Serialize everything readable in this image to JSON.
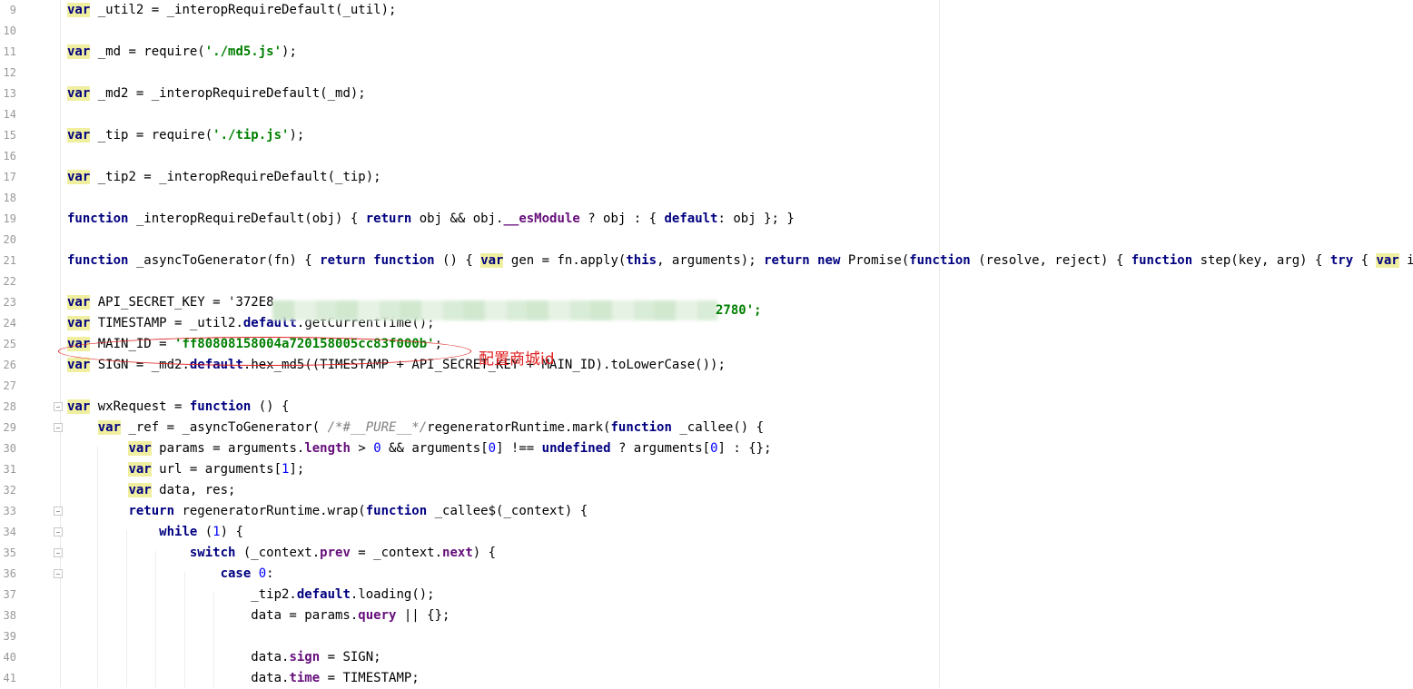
{
  "editor": {
    "lines": [
      {
        "num": "9",
        "text": "var _util2 = _interopRequireDefault(_util);"
      },
      {
        "num": "10",
        "text": ""
      },
      {
        "num": "11",
        "text": "var _md = require('./md5.js');"
      },
      {
        "num": "12",
        "text": ""
      },
      {
        "num": "13",
        "text": "var _md2 = _interopRequireDefault(_md);"
      },
      {
        "num": "14",
        "text": ""
      },
      {
        "num": "15",
        "text": "var _tip = require('./tip.js');"
      },
      {
        "num": "16",
        "text": ""
      },
      {
        "num": "17",
        "text": "var _tip2 = _interopRequireDefault(_tip);"
      },
      {
        "num": "18",
        "text": ""
      },
      {
        "num": "19",
        "text": "function _interopRequireDefault(obj) { return obj && obj.__esModule ? obj : { default: obj }; }"
      },
      {
        "num": "20",
        "text": ""
      },
      {
        "num": "21",
        "text": "function _asyncToGenerator(fn) { return function () { var gen = fn.apply(this, arguments); return new Promise(function (resolve, reject) { function step(key, arg) { try { var inf"
      },
      {
        "num": "22",
        "text": ""
      },
      {
        "num": "23",
        "text": "var API_SECRET_KEY = '372E8"
      },
      {
        "num": "24",
        "text": "var TIMESTAMP = _util2.default.getCurrentTime();"
      },
      {
        "num": "25",
        "text": "var MAIN_ID = 'ff80808158004a720158005cc83f000b';"
      },
      {
        "num": "26",
        "text": "var SIGN = _md2.default.hex_md5((TIMESTAMP + API_SECRET_KEY + MAIN_ID).toLowerCase());"
      },
      {
        "num": "27",
        "text": ""
      },
      {
        "num": "28",
        "text": "var wxRequest = function () {"
      },
      {
        "num": "29",
        "text": "    var _ref = _asyncToGenerator( /*#__PURE__*/regeneratorRuntime.mark(function _callee() {"
      },
      {
        "num": "30",
        "text": "        var params = arguments.length > 0 && arguments[0] !== undefined ? arguments[0] : {};"
      },
      {
        "num": "31",
        "text": "        var url = arguments[1];"
      },
      {
        "num": "32",
        "text": "        var data, res;"
      },
      {
        "num": "33",
        "text": "        return regeneratorRuntime.wrap(function _callee$(_context) {"
      },
      {
        "num": "34",
        "text": "            while (1) {"
      },
      {
        "num": "35",
        "text": "                switch (_context.prev = _context.next) {"
      },
      {
        "num": "36",
        "text": "                    case 0:"
      },
      {
        "num": "37",
        "text": "                        _tip2.default.loading();"
      },
      {
        "num": "38",
        "text": "                        data = params.query || {};"
      },
      {
        "num": "39",
        "text": ""
      },
      {
        "num": "40",
        "text": "                        data.sign = SIGN;"
      },
      {
        "num": "41",
        "text": "                        data.time = TIMESTAMP;"
      }
    ],
    "secret_tail": "2780';",
    "annotation": "配置商城id"
  }
}
